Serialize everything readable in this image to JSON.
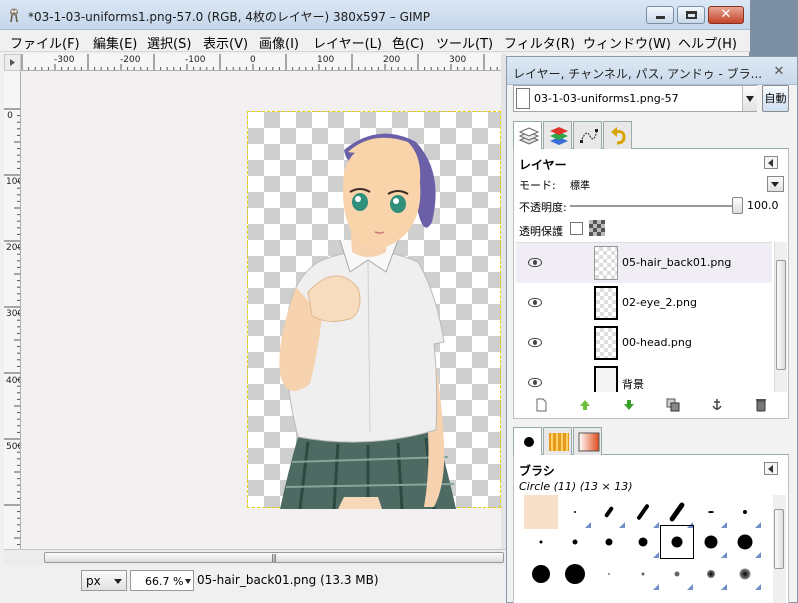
{
  "window": {
    "title": "*03-1-03-uniforms1.png-57.0 (RGB, 4枚のレイヤー) 380x597 – GIMP",
    "close_glyph": "✕"
  },
  "menu": [
    "ファイル(F)",
    "編集(E)",
    "選択(S)",
    "表示(V)",
    "画像(I)",
    "レイヤー(L)",
    "色(C)",
    "ツール(T)",
    "フィルタ(R)",
    "ウィンドウ(W)",
    "ヘルプ(H)"
  ],
  "ruler": {
    "h_labels": [
      "-300",
      "-200",
      "-100",
      "0",
      "100",
      "200",
      "300"
    ],
    "v_labels": [
      "0",
      "100",
      "200",
      "300",
      "400",
      "500"
    ]
  },
  "status": {
    "unit": "px",
    "zoom": "66.7 %",
    "text": "05-hair_back01.png (13.3 MB)"
  },
  "dock": {
    "title": "レイヤー, チャンネル, パス, アンドゥ - ブラ...",
    "close_glyph": "✕",
    "image_select": "03-1-03-uniforms1.png-57",
    "auto_label": "自動"
  },
  "layers": {
    "title": "レイヤー",
    "mode_label": "モード:",
    "mode_value": "標準",
    "opacity_label": "不透明度:",
    "opacity_value": "100.0",
    "lock_label": "透明保護",
    "items": [
      {
        "name": "05-hair_back01.png",
        "selected": true
      },
      {
        "name": "02-eye_2.png",
        "selected": false
      },
      {
        "name": "00-head.png",
        "selected": false
      },
      {
        "name": "背景",
        "selected": false
      }
    ]
  },
  "brushes": {
    "title": "ブラシ",
    "description": "Circle (11) (13 × 13)"
  }
}
